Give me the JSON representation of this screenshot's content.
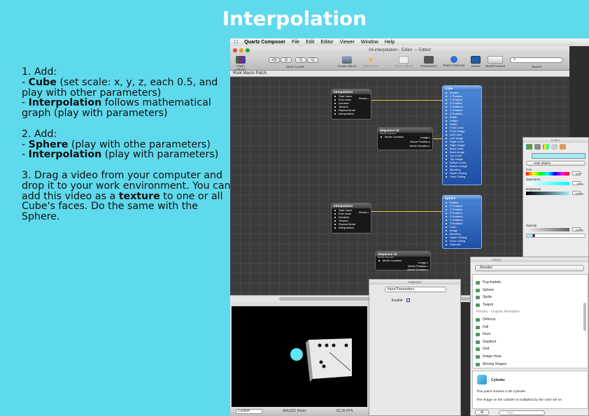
{
  "slide": {
    "title": "Interpolation",
    "step1": {
      "heading": "1. Add:",
      "a_bold": "Cube",
      "a_rest": " (set scale: x, y, z, each 0.5, and play with other parameters)",
      "b_bold": "Interpolation",
      "b_rest": " follows mathematical graph (play with parameters)"
    },
    "step2": {
      "heading": "2. Add:",
      "a_bold": "Sphere",
      "a_rest": " (play with othe parameters)",
      "b_bold": "Interpolation",
      "b_rest": " (play with parameters)"
    },
    "step3": {
      "text_a": "3. Drag a video from your computer and drop it to your work environment. You can add this video as a ",
      "bold": "texture",
      "text_b": " to one or all Cube's faces. Do the same with the Sphere."
    }
  },
  "menubar": {
    "apple": "",
    "items": [
      "Quartz Composer",
      "File",
      "Edit",
      "Editor",
      "Viewer",
      "Window",
      "Help"
    ]
  },
  "editor": {
    "window_title": "04-interpolation - Editor — Edited",
    "toolbar": {
      "patch_library": "Patch Library",
      "zoom_levels": "Zoom Levels",
      "create_macro": "Create Macro",
      "edit_parent": "Edit Parent",
      "add_to_library": "Add to Library",
      "parameters": "Parameters",
      "patch_inspector": "Patch Inspector",
      "viewer": "Viewer",
      "back_forward": "Back/Forward",
      "search": "Search",
      "zoom_btn_1": "+Qr",
      "zoom_btn_2": "Q",
      "zoom_btn_3": "Q",
      "zoom_btn_4": "Q"
    },
    "breadcrumb": "Root Macro Patch"
  },
  "patches": {
    "interp1": {
      "title": "Interpolation",
      "ports": [
        "Start Value",
        "End Value",
        "Duration",
        "Tension",
        "Repeat Mode",
        "Interpolation"
      ],
      "output": "Result"
    },
    "interp2": {
      "title": "Interpolation",
      "ports": [
        "Start Value",
        "End Value",
        "Duration",
        "Tension",
        "Repeat Mode",
        "Interpolation"
      ],
      "output": "Result"
    },
    "seq1": {
      "title": "Sequence 02",
      "subtitle": "Movie Importer",
      "input": "Movie Location",
      "outputs": [
        "Image",
        "Movie Position",
        "Movie Duration"
      ]
    },
    "seq2": {
      "title": "Sequence 15",
      "subtitle": "Movie Importer",
      "input": "Movie Location",
      "outputs": [
        "Image",
        "Movie Position",
        "Movie Duration"
      ]
    },
    "cube": {
      "title": "Cube",
      "ports": [
        "Enable",
        "X Position",
        "Y Position",
        "Z Position",
        "X Rotation",
        "Y Rotation",
        "Z Rotation",
        "Width",
        "Height",
        "Depth",
        "Front Color",
        "Front Image",
        "Left Color",
        "Left Image",
        "Right Color",
        "Right Image",
        "Back Color",
        "Back Image",
        "Top Color",
        "Top Image",
        "Bottom Color",
        "Bottom Image",
        "Blending",
        "Depth Testing",
        "Face Culling"
      ]
    },
    "sphere": {
      "title": "Sphere",
      "ports": [
        "Enable",
        "X Position",
        "Y Position",
        "Z Position",
        "X Rotation",
        "Y Rotation",
        "Z Rotation",
        "Color",
        "Image",
        "Blending",
        "Depth Testing",
        "Face Culling",
        "Diameter"
      ]
    }
  },
  "inspector": {
    "title": "Inspector",
    "selector": "Input Parameters",
    "enable_label": "Enable"
  },
  "viewer": {
    "mode": "Custom",
    "resolution": "454x322 Pixels",
    "fps": "62.25 FPS"
  },
  "colors_panel": {
    "title": "Colors",
    "mode": "HSB Sliders",
    "hue_label": "Hue",
    "hue_value": "180",
    "saturation_label": "Saturation",
    "saturation_value": "60",
    "brightness_label": "Brightness",
    "brightness_value": "100",
    "opacity_label": "Opacity",
    "opacity_value": "100",
    "percent": "%",
    "degree": "°",
    "swatch_color": "#a2ecf8"
  },
  "library": {
    "title": "Library",
    "category": "Render",
    "items": [
      {
        "label": "Psychedelic",
        "cat": false
      },
      {
        "label": "Sphere",
        "cat": false
      },
      {
        "label": "Sprite",
        "cat": false
      },
      {
        "label": "Teapot",
        "cat": false
      },
      {
        "label": "Render - Graphic Animation",
        "cat": true
      },
      {
        "label": "Defocus",
        "cat": false
      },
      {
        "label": "Fall",
        "cat": false
      },
      {
        "label": "Fluor",
        "cat": false
      },
      {
        "label": "Gradient",
        "cat": false
      },
      {
        "label": "Grid",
        "cat": false
      },
      {
        "label": "Image Hose",
        "cat": false
      },
      {
        "label": "Moving Shapes",
        "cat": false
      }
    ],
    "detail_name": "Cylinder",
    "detail_line1": "This patch renders a 3D Cylinder.",
    "detail_line2": "The image on the cylinder is multiplied by the color set on",
    "filter_placeholder": "Filter"
  }
}
